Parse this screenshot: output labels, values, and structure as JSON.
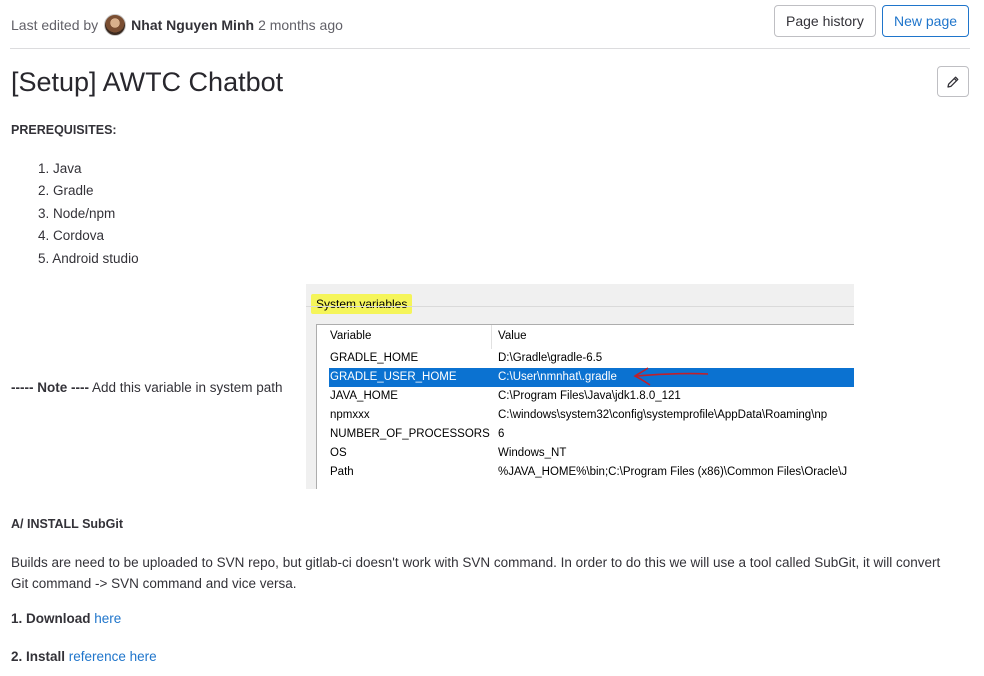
{
  "header": {
    "last_edited_prefix": "Last edited by",
    "author": "Nhat Nguyen Minh",
    "time_ago": "2 months ago",
    "page_history_label": "Page history",
    "new_page_label": "New page"
  },
  "page": {
    "title": "[Setup] AWTC Chatbot"
  },
  "prerequisites": {
    "heading": "PREREQUISITES:",
    "items": [
      "1. Java",
      "2. Gradle",
      "3. Node/npm",
      "4. Cordova",
      "5. Android studio"
    ]
  },
  "note": {
    "dashes_left": "----- Note ----",
    "text": " Add this variable in system path"
  },
  "screenshot": {
    "section_label": "System variables",
    "col_variable": "Variable",
    "col_value": "Value",
    "rows": [
      {
        "variable": "GRADLE_HOME",
        "value": "D:\\Gradle\\gradle-6.5"
      },
      {
        "variable": "GRADLE_USER_HOME",
        "value": "C:\\User\\nmnhat\\.gradle"
      },
      {
        "variable": "JAVA_HOME",
        "value": "C:\\Program Files\\Java\\jdk1.8.0_121"
      },
      {
        "variable": "npmxxx",
        "value": "C:\\windows\\system32\\config\\systemprofile\\AppData\\Roaming\\np"
      },
      {
        "variable": "NUMBER_OF_PROCESSORS",
        "value": "6"
      },
      {
        "variable": "OS",
        "value": "Windows_NT"
      },
      {
        "variable": "Path",
        "value": "%JAVA_HOME%\\bin;C:\\Program Files (x86)\\Common Files\\Oracle\\J"
      }
    ],
    "highlight_color": "#0b72d1",
    "arrow_color": "#c0202a"
  },
  "section_a": {
    "heading": "A/ INSTALL SubGit",
    "paragraph": "Builds are need to be uploaded to SVN repo, but gitlab-ci doesn't work with SVN command. In order to do this we will use a tool called SubGit, it will convert Git command -> SVN command and vice versa.",
    "step1_label": "1. Download",
    "step1_link": "here",
    "step2_label": "2. Install",
    "step2_link": "reference here"
  },
  "colors": {
    "link": "#1f75cb",
    "highlight_yellow": "#f5f55a"
  }
}
